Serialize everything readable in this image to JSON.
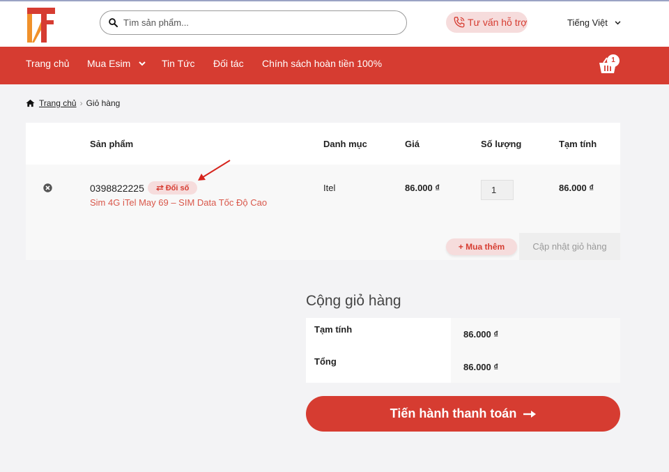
{
  "header": {
    "search_placeholder": "Tìm sản phẩm...",
    "support_label": "Tư vấn hỗ trợ",
    "language_label": "Tiếng Việt"
  },
  "nav": {
    "items": [
      "Trang chủ",
      "Mua Esim",
      "Tin Tức",
      "Đối tác",
      "Chính sách hoàn tiền 100%"
    ],
    "cart_count": "1"
  },
  "breadcrumb": {
    "home": "Trang chủ",
    "current": "Giỏ hàng"
  },
  "cart": {
    "columns": [
      "Sản phẩm",
      "Danh mục",
      "Giá",
      "Số lượng",
      "Tạm tính"
    ],
    "item": {
      "phone_number": "0398822225",
      "swap_label": "Đổi số",
      "product_name": "Sim 4G iTel May 69 – SIM Data Tốc Độ Cao",
      "category": "Itel",
      "price": "86.000 ₫",
      "quantity": "1",
      "subtotal": "86.000 ₫"
    },
    "buy_more_label": "+ Mua thêm",
    "update_label": "Cập nhật giỏ hàng"
  },
  "totals": {
    "title": "Cộng giỏ hàng",
    "subtotal_label": "Tạm tính",
    "subtotal_value": "86.000 ₫",
    "total_label": "Tổng",
    "total_value": "86.000 ₫",
    "checkout_label": "Tiến hành thanh toán"
  },
  "colors": {
    "brand": "#d63c31",
    "brand_light": "#f6dcdc",
    "logo_orange": "#f0912a"
  },
  "icons": [
    "logo",
    "search-icon",
    "phone-icon",
    "chevron-down-icon",
    "cart-icon",
    "home-icon",
    "remove-icon",
    "swap-icon",
    "arrow-right-icon",
    "annotation-arrow"
  ]
}
